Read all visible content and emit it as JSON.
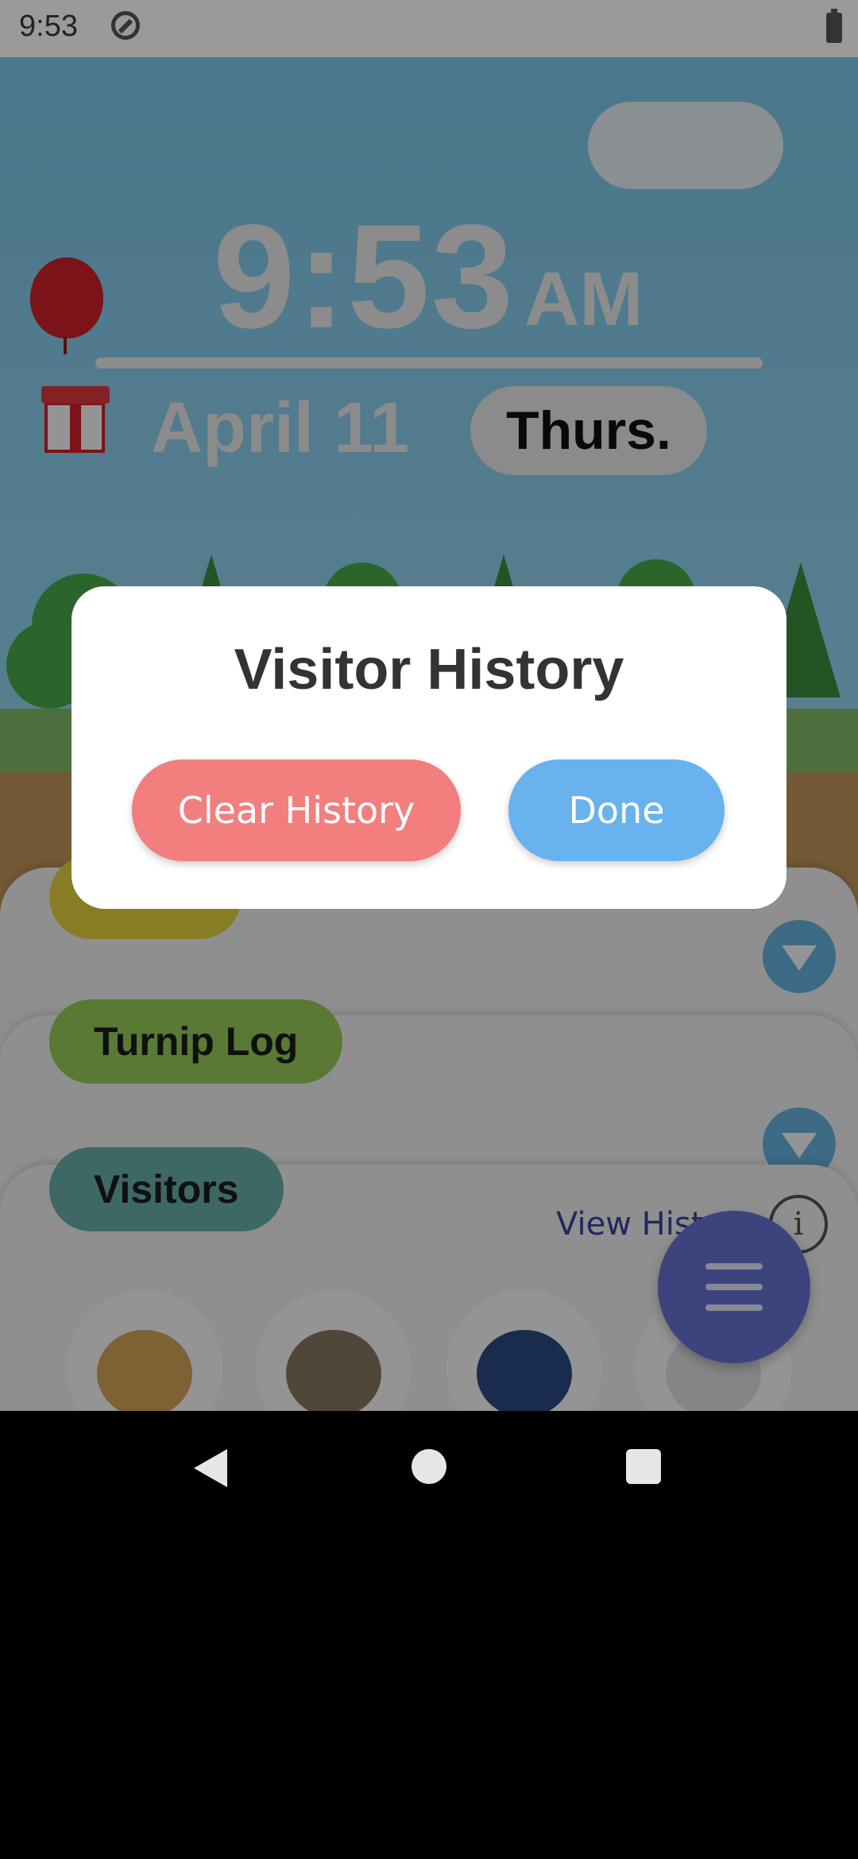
{
  "status_bar": {
    "time": "9:53"
  },
  "clock": {
    "time": "9:53",
    "ampm": "AM",
    "date": "April 11",
    "day": "Thurs."
  },
  "cards": {
    "turnip_log": "Turnip Log",
    "visitors": "Visitors",
    "view_history": "View History",
    "info_glyph": "i"
  },
  "dialog": {
    "title": "Visitor History",
    "clear_label": "Clear History",
    "done_label": "Done"
  }
}
